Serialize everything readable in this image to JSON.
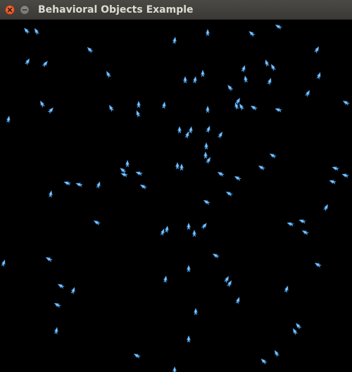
{
  "window": {
    "title": "Behavioral Objects Example",
    "controls": {
      "close": "close",
      "minimize": "minimize"
    }
  },
  "scene": {
    "background": "#000000",
    "agent_color": "#4aa0e8",
    "agent_highlight": "#a8d4ff"
  }
}
